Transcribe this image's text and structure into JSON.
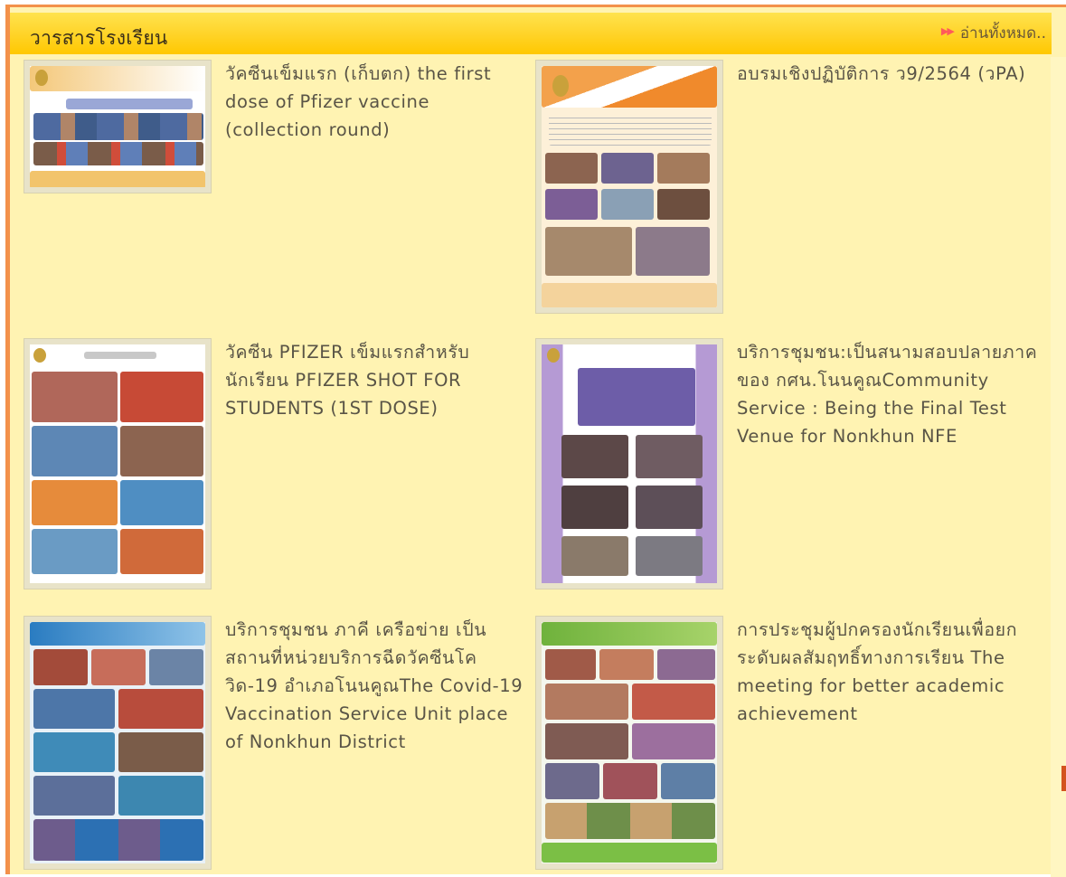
{
  "section": {
    "title": "วารสารโรงเรียน",
    "read_all_label": "อ่านทั้งหมด..",
    "read_all_icon": "double-arrow-icon"
  },
  "colors": {
    "frame_border": "#f3914b",
    "header_gradient_top": "#ffe34e",
    "header_gradient_bottom": "#ffc800",
    "body_bg": "#fff3b2",
    "text": "#595446"
  },
  "articles": [
    {
      "title": "วัคซีนเข็มแรก (เก็บตก) the first dose of Pfizer vaccine (collection round)",
      "thumbnail_icon": "newsletter-thumbnail",
      "thumb_theme": "orange-banner"
    },
    {
      "title": "อบรมเชิงปฏิบัติการ ว9/2564 (วPA)",
      "thumbnail_icon": "newsletter-thumbnail",
      "thumb_theme": "orange-poster"
    },
    {
      "title": "วัคซีน PFIZER เข็มแรกสำหรับนักเรียน PFIZER SHOT FOR STUDENTS (1ST DOSE)",
      "thumbnail_icon": "newsletter-thumbnail",
      "thumb_theme": "white-poster"
    },
    {
      "title": "บริการชุมชน:เป็นสนามสอบปลายภาคของ กศน.โนนคูณCommunity Service : Being the Final Test Venue for Nonkhun NFE",
      "thumbnail_icon": "newsletter-thumbnail",
      "thumb_theme": "purple-poster"
    },
    {
      "title": "บริการชุมชน ภาคี เครือข่าย เป็นสถานที่หน่วยบริการฉีดวัคซีนโควิด-19 อำเภอโนนคูณThe Covid-19 Vaccination Service Unit place of Nonkhun District",
      "thumbnail_icon": "newsletter-thumbnail",
      "thumb_theme": "blue-poster"
    },
    {
      "title": "การประชุมผู้ปกครองนักเรียนเพื่อยกระดับผลสัมฤทธิ์ทางการเรียน The meeting for better academic achievement",
      "thumbnail_icon": "newsletter-thumbnail",
      "thumb_theme": "green-poster"
    }
  ]
}
